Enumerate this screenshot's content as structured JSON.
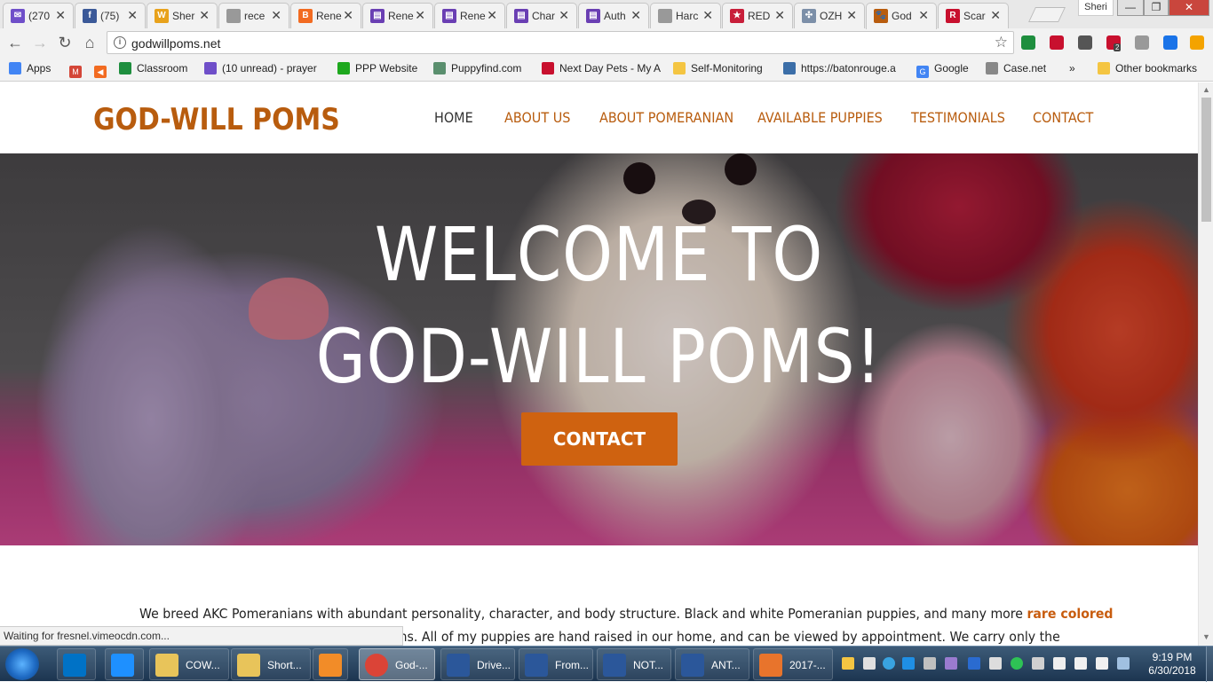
{
  "browser": {
    "tabs": [
      {
        "title": "(270",
        "color": "#6f4fc9",
        "glyph": "✉"
      },
      {
        "title": "(75)",
        "color": "#3b5998",
        "glyph": "f"
      },
      {
        "title": "Sher",
        "color": "#e8a21c",
        "glyph": "W"
      },
      {
        "title": "rece",
        "color": "#999999",
        "glyph": ""
      },
      {
        "title": "Rene",
        "color": "#f26b21",
        "glyph": "B"
      },
      {
        "title": "Rene",
        "color": "#6a3fb3",
        "glyph": "▤"
      },
      {
        "title": "Rene",
        "color": "#6a3fb3",
        "glyph": "▤"
      },
      {
        "title": "Char",
        "color": "#6a3fb3",
        "glyph": "▤"
      },
      {
        "title": "Auth",
        "color": "#6a3fb3",
        "glyph": "▤"
      },
      {
        "title": "Harc",
        "color": "#999999",
        "glyph": ""
      },
      {
        "title": "RED",
        "color": "#c81e3a",
        "glyph": "★"
      },
      {
        "title": "OZH",
        "color": "#7c8fa8",
        "glyph": "✣"
      },
      {
        "title": "God",
        "color": "#b85c0e",
        "glyph": "🐾"
      },
      {
        "title": "Scar",
        "color": "#c8102e",
        "glyph": "R"
      }
    ],
    "active_tab_index": 12,
    "user_chip": "Sheri",
    "window_controls": {
      "minimize": "—",
      "maximize": "❐",
      "close": "✕"
    },
    "tab_close": "✕",
    "nav": {
      "back": "←",
      "forward": "→",
      "reload": "↻",
      "home": "⌂"
    },
    "url": "godwillpoms.net",
    "info_glyph": "i",
    "star_glyph": "☆",
    "extensions": [
      {
        "name": "classroom-ext",
        "color": "#1e8e3e"
      },
      {
        "name": "video-ext",
        "color": "#c8102e"
      },
      {
        "name": "screenshot-ext",
        "color": "#555555"
      },
      {
        "name": "adblock-ext",
        "color": "#c8102e",
        "badge": "2"
      },
      {
        "name": "pdf-ext",
        "color": "#999999"
      },
      {
        "name": "snowflake-ext",
        "color": "#1a73e8"
      },
      {
        "name": "update-ext",
        "color": "#f4a300"
      }
    ],
    "bookmarks": [
      {
        "label": "Apps",
        "color": "#4285f4"
      },
      {
        "label": "",
        "color": "#d44638",
        "glyph": "M"
      },
      {
        "label": "",
        "color": "#f26b21",
        "glyph": "◀"
      },
      {
        "label": "Classroom",
        "color": "#1e8e3e"
      },
      {
        "label": "(10 unread) - prayer",
        "color": "#6f4fc9"
      },
      {
        "label": "PPP Website",
        "color": "#1ea81e"
      },
      {
        "label": "Puppyfind.com",
        "color": "#5a8f6e"
      },
      {
        "label": "Next Day Pets - My A",
        "color": "#c8102e"
      },
      {
        "label": "Self-Monitoring",
        "color": "#f4c542"
      },
      {
        "label": "https://batonrouge.a",
        "color": "#3b6ea8"
      },
      {
        "label": "Google",
        "color": "#4285f4",
        "glyph": "G"
      },
      {
        "label": "Case.net",
        "color": "#888888"
      }
    ],
    "bookmarks_overflow": "»",
    "other_bookmarks": "Other bookmarks",
    "status_text": "Waiting for fresnel.vimeocdn.com..."
  },
  "site": {
    "logo": "GOD-WILL POMS",
    "nav": [
      "HOME",
      "ABOUT US",
      "ABOUT POMERANIAN",
      "AVAILABLE PUPPIES",
      "TESTIMONIALS",
      "CONTACT"
    ],
    "hero_line1": "WELCOME TO",
    "hero_line2": "GOD-WILL POMS!",
    "hero_button": "CONTACT",
    "intro_line1_a": "We breed AKC Pomeranians with abundant personality, character, and body structure. Black and white Pomeranian puppies, and many more ",
    "intro_line1_b": "rare colored",
    "intro_line2": "oms. All of my puppies are hand raised in our home, and can be viewed by appointment. We carry only the",
    "accent_color": "#b85c0e",
    "button_color": "#cf6210"
  },
  "taskbar": {
    "items": [
      {
        "label": "",
        "color": "#0072c6",
        "name": "outlook"
      },
      {
        "label": "",
        "color": "#1e90ff",
        "name": "internet-explorer"
      },
      {
        "label": "COW...",
        "color": "#e8c45a",
        "name": "folder-cow"
      },
      {
        "label": "Short...",
        "color": "#e8c45a",
        "name": "folder-short"
      },
      {
        "label": "",
        "color": "#f28c28",
        "name": "media-player"
      },
      {
        "label": "God-...",
        "color": "#db4437",
        "name": "chrome-god"
      },
      {
        "label": "Drive...",
        "color": "#2b579a",
        "name": "word-drive"
      },
      {
        "label": "From...",
        "color": "#2b579a",
        "name": "word-from"
      },
      {
        "label": "NOT...",
        "color": "#2b579a",
        "name": "word-not"
      },
      {
        "label": "ANT...",
        "color": "#2b579a",
        "name": "word-ant"
      },
      {
        "label": "2017-...",
        "color": "#e8742c",
        "name": "powerpoint-2017"
      }
    ],
    "time": "9:19 PM",
    "date": "6/30/2018"
  }
}
